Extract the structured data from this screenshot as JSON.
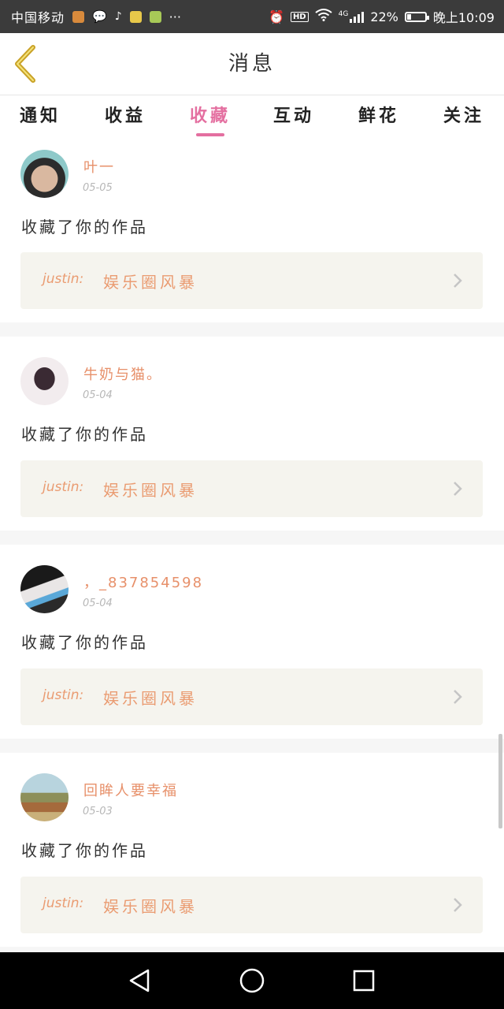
{
  "status_bar": {
    "carrier": "中国移动",
    "more": "···",
    "network": "4G",
    "battery": "22%",
    "battery_level": 0.22,
    "time": "晚上10:09",
    "app_icons": [
      "app-icon-orange",
      "wechat-icon",
      "tiktok-icon",
      "app-icon-yellow",
      "app-icon-green"
    ]
  },
  "header": {
    "title": "消息"
  },
  "tabs": [
    {
      "label": "通知",
      "active": false
    },
    {
      "label": "收益",
      "active": false
    },
    {
      "label": "收藏",
      "active": true
    },
    {
      "label": "互动",
      "active": false
    },
    {
      "label": "鲜花",
      "active": false
    },
    {
      "label": "关注",
      "active": false
    }
  ],
  "items": [
    {
      "name": "叶一",
      "date": "05-05",
      "action": "收藏了你的作品",
      "author": "justin:",
      "work": "娱乐圈风暴"
    },
    {
      "name": "牛奶与猫。",
      "date": "05-04",
      "action": "收藏了你的作品",
      "author": "justin:",
      "work": "娱乐圈风暴"
    },
    {
      "name": "，_837854598",
      "date": "05-04",
      "action": "收藏了你的作品",
      "author": "justin:",
      "work": "娱乐圈风暴"
    },
    {
      "name": "回眸人要幸福",
      "date": "05-03",
      "action": "收藏了你的作品",
      "author": "justin:",
      "work": "娱乐圈风暴"
    }
  ],
  "colors": {
    "accent": "#e46fa0",
    "username": "#e7906a",
    "work_text": "#ea9c72",
    "work_bg": "#f5f4ee",
    "back_arrow": "#c9a227"
  }
}
